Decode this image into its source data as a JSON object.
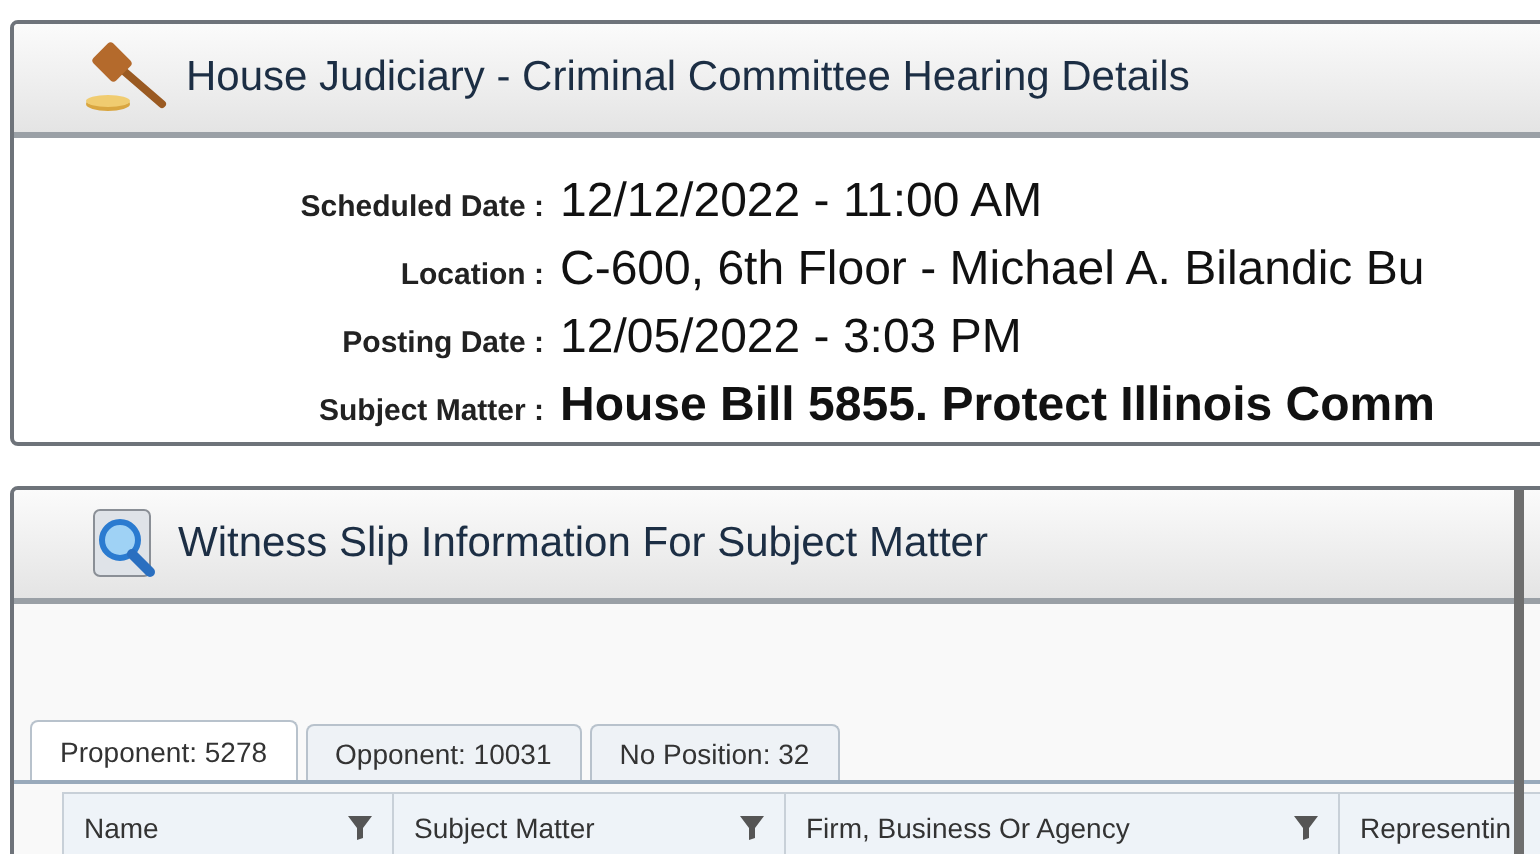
{
  "hearing_panel": {
    "title": "House Judiciary - Criminal Committee Hearing Details",
    "fields": [
      {
        "label": "Scheduled Date :",
        "value": "12/12/2022 - 11:00 AM",
        "kind": "plain"
      },
      {
        "label": "Location :",
        "value": "C-600, 6th Floor - Michael A. Bilandic Bu",
        "kind": "plain"
      },
      {
        "label": "Posting Date :",
        "value": "12/05/2022 - 3:03 PM",
        "kind": "plain"
      },
      {
        "label": "Subject Matter :",
        "value": "House Bill 5855. Protect Illinois Comm",
        "kind": "bold"
      }
    ]
  },
  "witness_panel": {
    "title": "Witness Slip Information For Subject Matter",
    "tabs": [
      {
        "label": "Proponent: 5278",
        "selected": true
      },
      {
        "label": "Opponent: 10031",
        "selected": false
      },
      {
        "label": "No Position: 32",
        "selected": false
      }
    ],
    "table": {
      "columns": [
        {
          "label": "Name",
          "filter": true
        },
        {
          "label": "Subject Matter",
          "filter": true
        },
        {
          "label": "Firm, Business Or Agency",
          "filter": true
        },
        {
          "label": "Representin",
          "filter": false
        }
      ]
    }
  }
}
